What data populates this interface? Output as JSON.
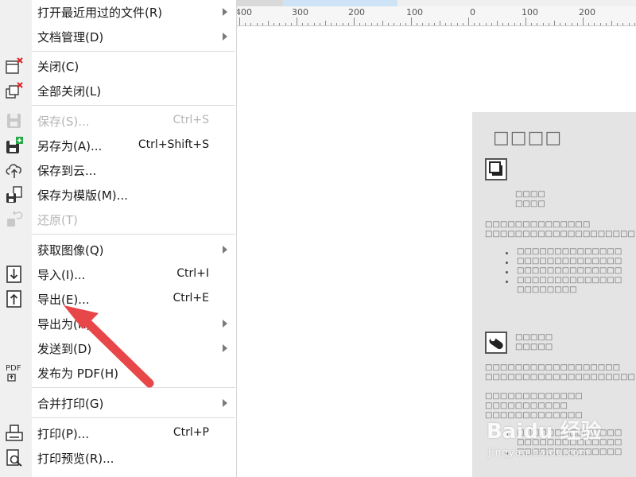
{
  "menu": {
    "items": [
      {
        "label": "打开最近用过的文件(R)",
        "shortcut": "",
        "submenu": true,
        "disabled": false,
        "icon": ""
      },
      {
        "label": "文档管理(D)",
        "shortcut": "",
        "submenu": true,
        "disabled": false,
        "icon": ""
      },
      {
        "label": "关闭(C)",
        "shortcut": "",
        "submenu": false,
        "disabled": false,
        "icon": "close-document-icon"
      },
      {
        "label": "全部关闭(L)",
        "shortcut": "",
        "submenu": false,
        "disabled": false,
        "icon": "close-all-icon"
      },
      {
        "label": "保存(S)...",
        "shortcut": "Ctrl+S",
        "submenu": false,
        "disabled": true,
        "icon": "save-icon"
      },
      {
        "label": "另存为(A)...",
        "shortcut": "Ctrl+Shift+S",
        "submenu": false,
        "disabled": false,
        "icon": "save-as-icon"
      },
      {
        "label": "保存到云...",
        "shortcut": "",
        "submenu": false,
        "disabled": false,
        "icon": "cloud-upload-icon"
      },
      {
        "label": "保存为模版(M)...",
        "shortcut": "",
        "submenu": false,
        "disabled": false,
        "icon": "save-template-icon"
      },
      {
        "label": "还原(T)",
        "shortcut": "",
        "submenu": false,
        "disabled": true,
        "icon": "revert-icon"
      },
      {
        "label": "获取图像(Q)",
        "shortcut": "",
        "submenu": true,
        "disabled": false,
        "icon": ""
      },
      {
        "label": "导入(I)...",
        "shortcut": "Ctrl+I",
        "submenu": false,
        "disabled": false,
        "icon": "import-icon"
      },
      {
        "label": "导出(E)...",
        "shortcut": "Ctrl+E",
        "submenu": false,
        "disabled": false,
        "icon": "export-icon"
      },
      {
        "label": "导出为(R)",
        "shortcut": "",
        "submenu": true,
        "disabled": false,
        "icon": ""
      },
      {
        "label": "发送到(D)",
        "shortcut": "",
        "submenu": true,
        "disabled": false,
        "icon": ""
      },
      {
        "label": "发布为 PDF(H)",
        "shortcut": "",
        "submenu": false,
        "disabled": false,
        "icon": "pdf-icon"
      },
      {
        "label": "合并打印(G)",
        "shortcut": "",
        "submenu": true,
        "disabled": false,
        "icon": ""
      },
      {
        "label": "打印(P)...",
        "shortcut": "Ctrl+P",
        "submenu": false,
        "disabled": false,
        "icon": "print-icon"
      },
      {
        "label": "打印预览(R)...",
        "shortcut": "",
        "submenu": false,
        "disabled": false,
        "icon": "print-preview-icon"
      }
    ]
  },
  "ruler": {
    "labels": [
      "400",
      "300",
      "200",
      "100",
      "0",
      "100",
      "200"
    ]
  },
  "icons": {
    "pdf_text": "PDF"
  },
  "watermark": {
    "logo": "Baidu 经验",
    "sub": "jingyan.baidu.com"
  },
  "colors": {
    "annotation_arrow": "#e8474a",
    "menu_gutter": "#f0f0f0",
    "disabled_text": "#b5b5b5"
  }
}
